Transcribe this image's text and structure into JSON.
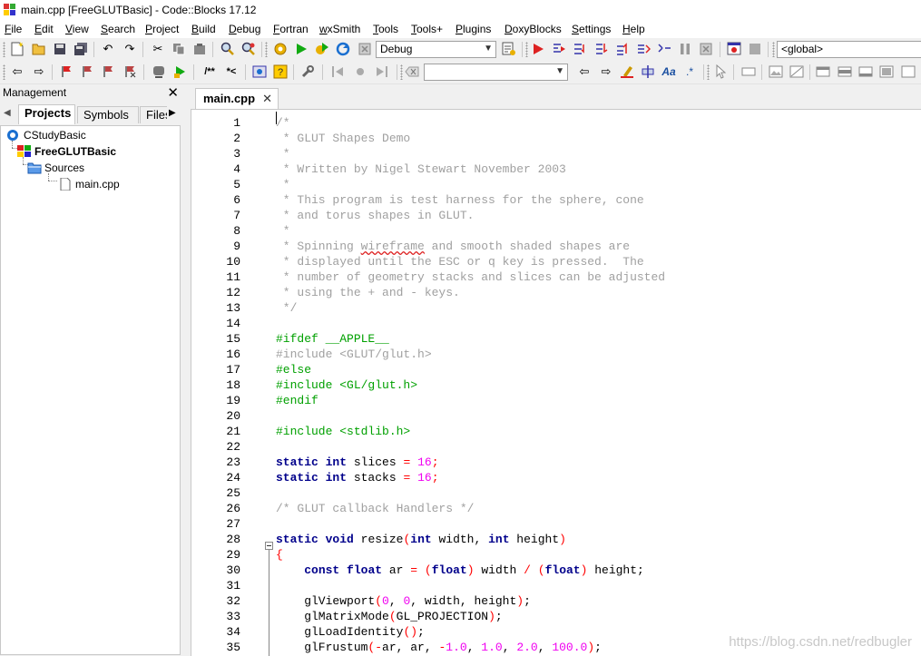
{
  "window": {
    "title": "main.cpp [FreeGLUTBasic] - Code::Blocks 17.12"
  },
  "menu": [
    {
      "label": "File",
      "u": "F",
      "rest": "ile"
    },
    {
      "label": "Edit",
      "u": "E",
      "rest": "dit"
    },
    {
      "label": "View",
      "u": "V",
      "rest": "iew"
    },
    {
      "label": "Search",
      "u": "S",
      "rest": "earch"
    },
    {
      "label": "Project",
      "u": "P",
      "rest": "roject"
    },
    {
      "label": "Build",
      "u": "B",
      "rest": "uild"
    },
    {
      "label": "Debug",
      "u": "D",
      "rest": "ebug"
    },
    {
      "label": "Fortran",
      "u": "F",
      "rest": "ortran"
    },
    {
      "label": "wxSmith",
      "u": "w",
      "rest": "xSmith"
    },
    {
      "label": "Tools",
      "u": "T",
      "rest": "ools"
    },
    {
      "label": "Tools+",
      "u": "T",
      "rest": "ools+"
    },
    {
      "label": "Plugins",
      "u": "P",
      "rest": "lugins"
    },
    {
      "label": "DoxyBlocks",
      "u": "D",
      "rest": "oxyBlocks"
    },
    {
      "label": "Settings",
      "u": "S",
      "rest": "ettings"
    },
    {
      "label": "Help",
      "u": "H",
      "rest": "elp"
    }
  ],
  "toolbar": {
    "build_target": "Debug",
    "scope": "<global>",
    "comment_block": "/**",
    "comment_line": "*<",
    "symbol_search": ""
  },
  "management": {
    "title": "Management",
    "tabs": [
      "Projects",
      "Symbols",
      "Files"
    ],
    "tree": [
      {
        "label": "CStudyBasic",
        "icon": "workspace-icon",
        "bold": false
      },
      {
        "label": "FreeGLUTBasic",
        "icon": "project-icon",
        "bold": true
      },
      {
        "label": "Sources",
        "icon": "folder-icon",
        "bold": false
      },
      {
        "label": "main.cpp",
        "icon": "file-icon",
        "bold": false
      }
    ]
  },
  "editor": {
    "tab_label": "main.cpp",
    "lines": [
      [
        {
          "t": "/*",
          "c": "com"
        }
      ],
      [
        {
          "t": " * GLUT Shapes Demo",
          "c": "com"
        }
      ],
      [
        {
          "t": " *",
          "c": "com"
        }
      ],
      [
        {
          "t": " * Written by Nigel Stewart November 2003",
          "c": "com"
        }
      ],
      [
        {
          "t": " *",
          "c": "com"
        }
      ],
      [
        {
          "t": " * This program is test harness for the sphere, cone",
          "c": "com"
        }
      ],
      [
        {
          "t": " * and torus shapes in GLUT.",
          "c": "com"
        }
      ],
      [
        {
          "t": " *",
          "c": "com"
        }
      ],
      [
        {
          "t": " * Spinning wireframe and smooth shaded shapes are",
          "c": "com"
        }
      ],
      [
        {
          "t": " * displayed until the ESC or q key is pressed.  The",
          "c": "com"
        }
      ],
      [
        {
          "t": " * number of geometry stacks and slices can be adjusted",
          "c": "com"
        }
      ],
      [
        {
          "t": " * using the + and - keys.",
          "c": "com"
        }
      ],
      [
        {
          "t": " */",
          "c": "com"
        }
      ],
      [],
      [
        {
          "t": "#ifdef __APPLE__",
          "c": "pp"
        }
      ],
      [
        {
          "t": "#include <GLUT/glut.h>",
          "c": "com"
        }
      ],
      [
        {
          "t": "#else",
          "c": "pp"
        }
      ],
      [
        {
          "t": "#include <GL/glut.h>",
          "c": "pp"
        }
      ],
      [
        {
          "t": "#endif",
          "c": "pp"
        }
      ],
      [],
      [
        {
          "t": "#include <stdlib.h>",
          "c": "pp"
        }
      ],
      [],
      [
        {
          "t": "static",
          "c": "kw"
        },
        {
          "t": " ",
          "c": "txt"
        },
        {
          "t": "int",
          "c": "kw"
        },
        {
          "t": " slices ",
          "c": "txt"
        },
        {
          "t": "=",
          "c": "op"
        },
        {
          "t": " ",
          "c": "txt"
        },
        {
          "t": "16",
          "c": "num"
        },
        {
          "t": ";",
          "c": "op"
        }
      ],
      [
        {
          "t": "static",
          "c": "kw"
        },
        {
          "t": " ",
          "c": "txt"
        },
        {
          "t": "int",
          "c": "kw"
        },
        {
          "t": " stacks ",
          "c": "txt"
        },
        {
          "t": "=",
          "c": "op"
        },
        {
          "t": " ",
          "c": "txt"
        },
        {
          "t": "16",
          "c": "num"
        },
        {
          "t": ";",
          "c": "op"
        }
      ],
      [],
      [
        {
          "t": "/* GLUT callback Handlers */",
          "c": "com"
        }
      ],
      [],
      [
        {
          "t": "static",
          "c": "kw"
        },
        {
          "t": " ",
          "c": "txt"
        },
        {
          "t": "void",
          "c": "kw"
        },
        {
          "t": " resize",
          "c": "txt"
        },
        {
          "t": "(",
          "c": "op"
        },
        {
          "t": "int",
          "c": "kw"
        },
        {
          "t": " width, ",
          "c": "txt"
        },
        {
          "t": "int",
          "c": "kw"
        },
        {
          "t": " height",
          "c": "txt"
        },
        {
          "t": ")",
          "c": "op"
        }
      ],
      [
        {
          "t": "{",
          "c": "op"
        }
      ],
      [
        {
          "t": "    ",
          "c": "txt"
        },
        {
          "t": "const",
          "c": "kw"
        },
        {
          "t": " ",
          "c": "txt"
        },
        {
          "t": "float",
          "c": "kw"
        },
        {
          "t": " ar ",
          "c": "txt"
        },
        {
          "t": "=",
          "c": "op"
        },
        {
          "t": " ",
          "c": "txt"
        },
        {
          "t": "(",
          "c": "op"
        },
        {
          "t": "float",
          "c": "kw"
        },
        {
          "t": ")",
          "c": "op"
        },
        {
          "t": " width ",
          "c": "txt"
        },
        {
          "t": "/",
          "c": "op"
        },
        {
          "t": " ",
          "c": "txt"
        },
        {
          "t": "(",
          "c": "op"
        },
        {
          "t": "float",
          "c": "kw"
        },
        {
          "t": ")",
          "c": "op"
        },
        {
          "t": " height;",
          "c": "txt"
        }
      ],
      [],
      [
        {
          "t": "    glViewport",
          "c": "txt"
        },
        {
          "t": "(",
          "c": "op"
        },
        {
          "t": "0",
          "c": "num"
        },
        {
          "t": ", ",
          "c": "txt"
        },
        {
          "t": "0",
          "c": "num"
        },
        {
          "t": ", width, height",
          "c": "txt"
        },
        {
          "t": ")",
          "c": "op"
        },
        {
          "t": ";",
          "c": "txt"
        }
      ],
      [
        {
          "t": "    glMatrixMode",
          "c": "txt"
        },
        {
          "t": "(",
          "c": "op"
        },
        {
          "t": "GL_PROJECTION",
          "c": "txt"
        },
        {
          "t": ")",
          "c": "op"
        },
        {
          "t": ";",
          "c": "txt"
        }
      ],
      [
        {
          "t": "    glLoadIdentity",
          "c": "txt"
        },
        {
          "t": "()",
          "c": "op"
        },
        {
          "t": ";",
          "c": "txt"
        }
      ],
      [
        {
          "t": "    glFrustum",
          "c": "txt"
        },
        {
          "t": "(",
          "c": "op"
        },
        {
          "t": "-",
          "c": "op"
        },
        {
          "t": "ar, ar, ",
          "c": "txt"
        },
        {
          "t": "-",
          "c": "op"
        },
        {
          "t": "1.0",
          "c": "num"
        },
        {
          "t": ", ",
          "c": "txt"
        },
        {
          "t": "1.0",
          "c": "num"
        },
        {
          "t": ", ",
          "c": "txt"
        },
        {
          "t": "2.0",
          "c": "num"
        },
        {
          "t": ", ",
          "c": "txt"
        },
        {
          "t": "100.0",
          "c": "num"
        },
        {
          "t": ")",
          "c": "op"
        },
        {
          "t": ";",
          "c": "txt"
        }
      ]
    ]
  },
  "watermark": "https://blog.csdn.net/redbugler"
}
